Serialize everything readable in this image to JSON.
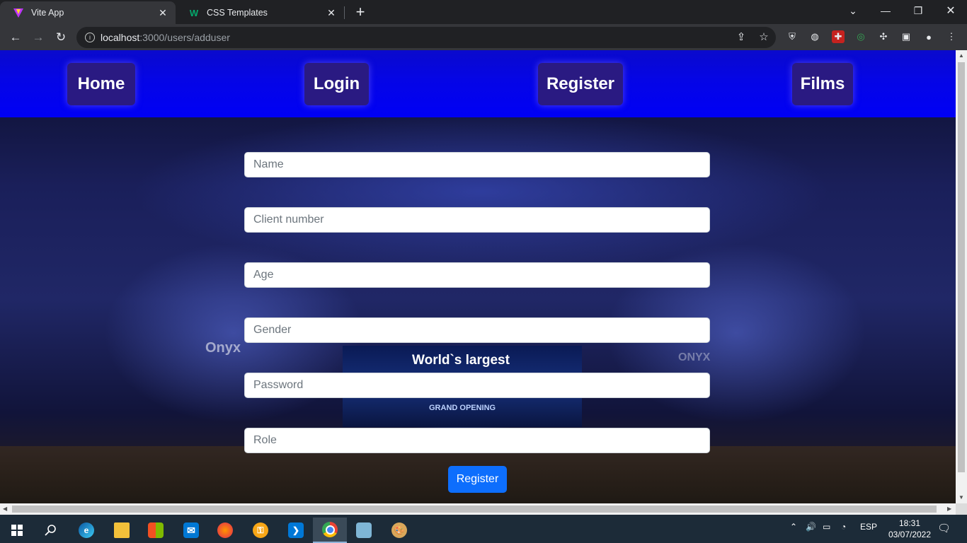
{
  "browser": {
    "tabs": [
      {
        "title": "Vite App",
        "icon": "vite-icon",
        "active": true
      },
      {
        "title": "CSS Templates",
        "icon": "w3schools-icon",
        "active": false
      }
    ],
    "url_host": "localhost",
    "url_path": ":3000/users/adduser"
  },
  "nav": {
    "home": "Home",
    "login": "Login",
    "register": "Register",
    "films": "Films"
  },
  "background": {
    "screen_title": "World`s largest",
    "screen_sub": "GRAND OPENING",
    "brand_left": "Onyx",
    "brand_right": "ONYX"
  },
  "form": {
    "name_placeholder": "Name",
    "client_number_placeholder": "Client number",
    "age_placeholder": "Age",
    "gender_placeholder": "Gender",
    "password_placeholder": "Password",
    "role_placeholder": "Role",
    "submit_label": "Register"
  },
  "taskbar": {
    "language": "ESP",
    "time": "18:31",
    "date": "03/07/2022"
  },
  "colors": {
    "navbar": "#0000f5",
    "nav_button": "#2a1a82",
    "submit": "#0d6efd"
  }
}
